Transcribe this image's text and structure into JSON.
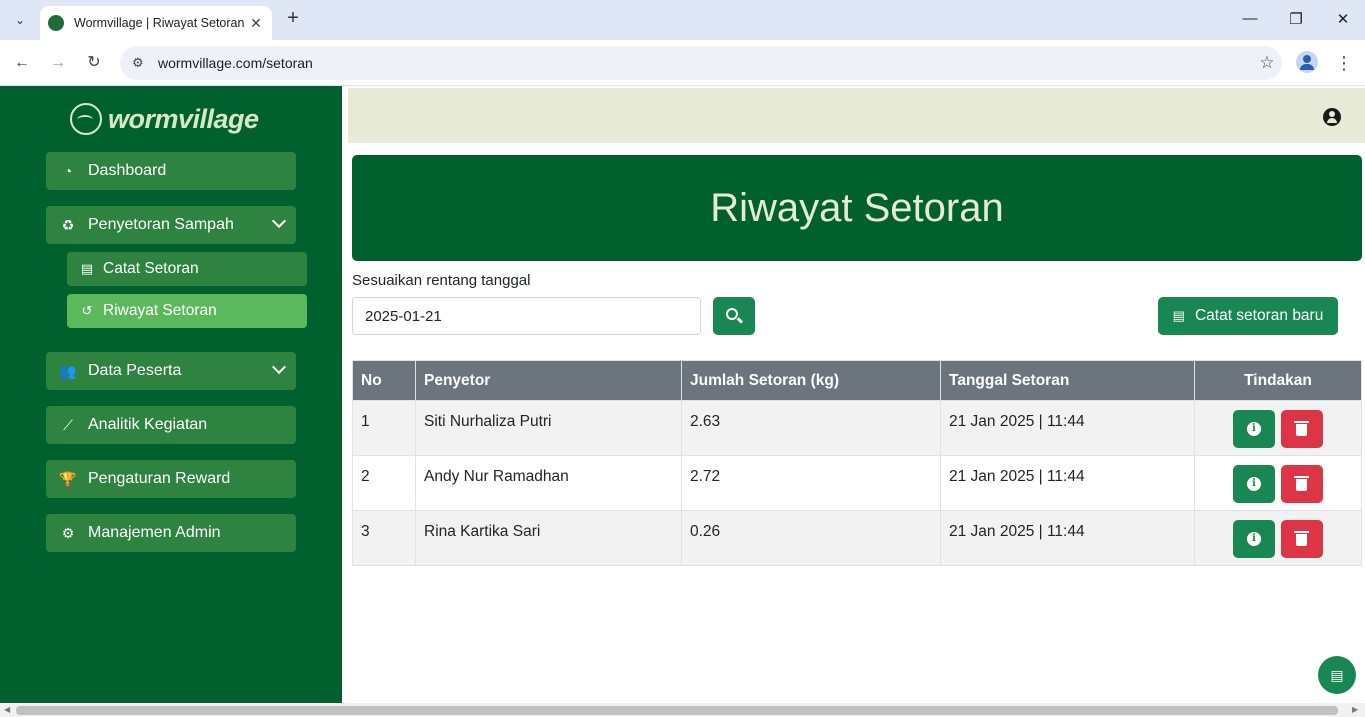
{
  "browser": {
    "tab_title": "Wormvillage | Riwayat Setoran",
    "url": "wormvillage.com/setoran"
  },
  "sidebar": {
    "logo_text": "wormvillage",
    "items": [
      {
        "label": "Dashboard",
        "icon": "gauge-icon"
      },
      {
        "label": "Penyetoran Sampah",
        "icon": "recycle-icon",
        "expanded": true
      },
      {
        "label": "Catat Setoran",
        "icon": "clipboard-icon"
      },
      {
        "label": "Riwayat Setoran",
        "icon": "history-icon",
        "active": true
      },
      {
        "label": "Data Peserta",
        "icon": "users-icon"
      },
      {
        "label": "Analitik Kegiatan",
        "icon": "chart-line-icon"
      },
      {
        "label": "Pengaturan Reward",
        "icon": "trophy-icon"
      },
      {
        "label": "Manajemen Admin",
        "icon": "user-gear-icon"
      }
    ]
  },
  "main": {
    "page_title": "Riwayat Setoran",
    "filter": {
      "label": "Sesuaikan rentang tanggal",
      "date_value": "2025-01-21"
    },
    "new_button_label": "Catat setoran baru",
    "table": {
      "headers": [
        "No",
        "Penyetor",
        "Jumlah Setoran (kg)",
        "Tanggal Setoran",
        "Tindakan"
      ],
      "rows": [
        {
          "no": "1",
          "name": "Siti Nurhaliza Putri",
          "amount": "2.63",
          "date": "21 Jan 2025 | 11:44"
        },
        {
          "no": "2",
          "name": "Andy Nur Ramadhan",
          "amount": "2.72",
          "date": "21 Jan 2025 | 11:44"
        },
        {
          "no": "3",
          "name": "Rina Kartika Sari",
          "amount": "0.26",
          "date": "21 Jan 2025 | 11:44"
        }
      ]
    }
  },
  "colors": {
    "sidebar_bg": "#00612f",
    "menu_item_bg": "#2e8340",
    "active_item_bg": "#5cb85c",
    "primary_button": "#198754",
    "danger_button": "#dc3545",
    "topbar_bg": "#e6ead6"
  }
}
